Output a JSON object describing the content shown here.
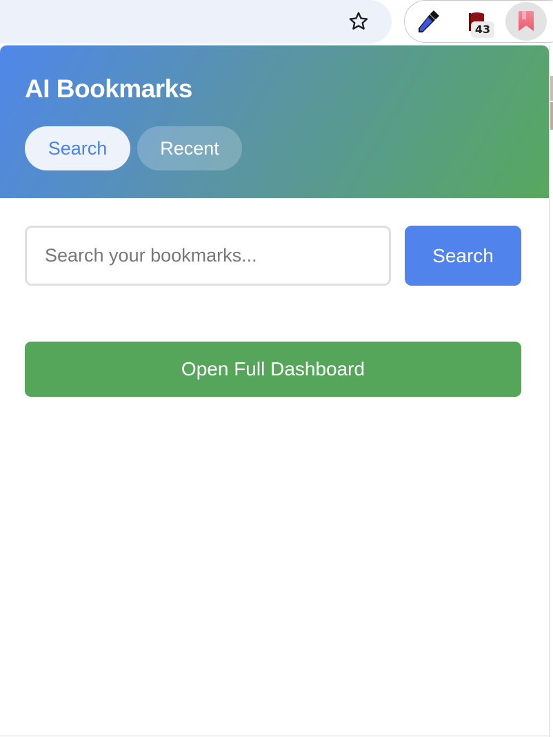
{
  "browser": {
    "toolbar": {
      "bookmark_star_icon": "star-outline-icon",
      "extensions": [
        {
          "name": "eyedropper",
          "icon": "eyedropper-icon"
        },
        {
          "name": "flag-extension",
          "icon": "flag-icon",
          "badge": "43"
        },
        {
          "name": "ai-bookmarks",
          "icon": "bookmark-icon",
          "active": true
        }
      ]
    }
  },
  "popup": {
    "title": "AI Bookmarks",
    "tabs": [
      {
        "label": "Search",
        "active": true
      },
      {
        "label": "Recent",
        "active": false
      }
    ],
    "search": {
      "placeholder": "Search your bookmarks...",
      "value": "",
      "button_label": "Search"
    },
    "dashboard_button_label": "Open Full Dashboard"
  },
  "colors": {
    "header_gradient_start": "#4f87ea",
    "header_gradient_end": "#57a85e",
    "primary_blue": "#5183ec",
    "primary_green": "#55a65b",
    "active_tab_bg": "#eef3fb"
  }
}
